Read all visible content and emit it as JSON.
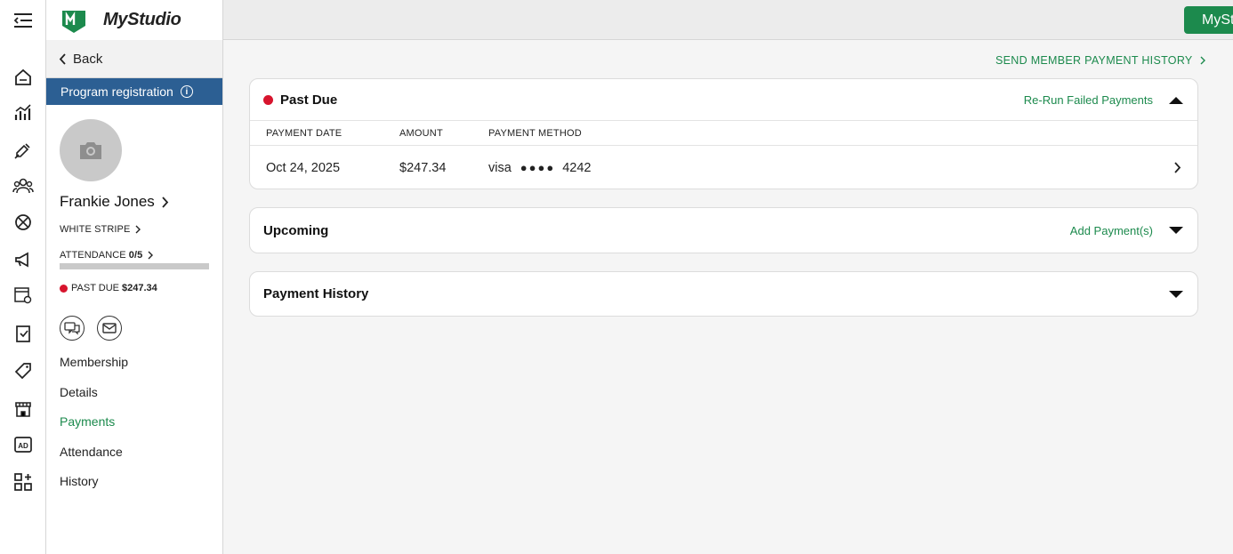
{
  "app": {
    "logo_text": "MyStudio",
    "top_button": "MySt"
  },
  "panel": {
    "back_label": "Back",
    "program_label": "Program registration",
    "member_name": "Frankie Jones",
    "rank": "WHITE STRIPE",
    "attendance_label": "ATTENDANCE",
    "attendance_value": "0/5",
    "attendance_fraction": 0,
    "past_due_label": "PAST DUE",
    "past_due_amount": "$247.34",
    "nav": [
      "Membership",
      "Details",
      "Payments",
      "Attendance",
      "History"
    ],
    "active_nav": "Payments"
  },
  "main": {
    "send_history_link": "SEND MEMBER PAYMENT HISTORY",
    "past_due": {
      "title": "Past Due",
      "action": "Re-Run Failed Payments",
      "columns": [
        "PAYMENT DATE",
        "AMOUNT",
        "PAYMENT METHOD"
      ],
      "rows": [
        {
          "date": "Oct 24, 2025",
          "amount": "$247.34",
          "card_brand": "visa",
          "masked": "●●●●",
          "last4": "4242"
        }
      ]
    },
    "upcoming": {
      "title": "Upcoming",
      "action": "Add Payment(s)"
    },
    "history": {
      "title": "Payment History"
    }
  },
  "colors": {
    "accent": "#1c8a4d",
    "program_bar": "#2c5f93",
    "past_due_red": "#d7142d"
  },
  "icons": [
    "menu-collapse-icon",
    "home-icon",
    "analytics-icon",
    "leads-icon",
    "members-icon",
    "programs-icon",
    "marketing-icon",
    "schedule-settings-icon",
    "tasks-icon",
    "tags-icon",
    "store-icon",
    "ad-icon",
    "apps-icon"
  ]
}
